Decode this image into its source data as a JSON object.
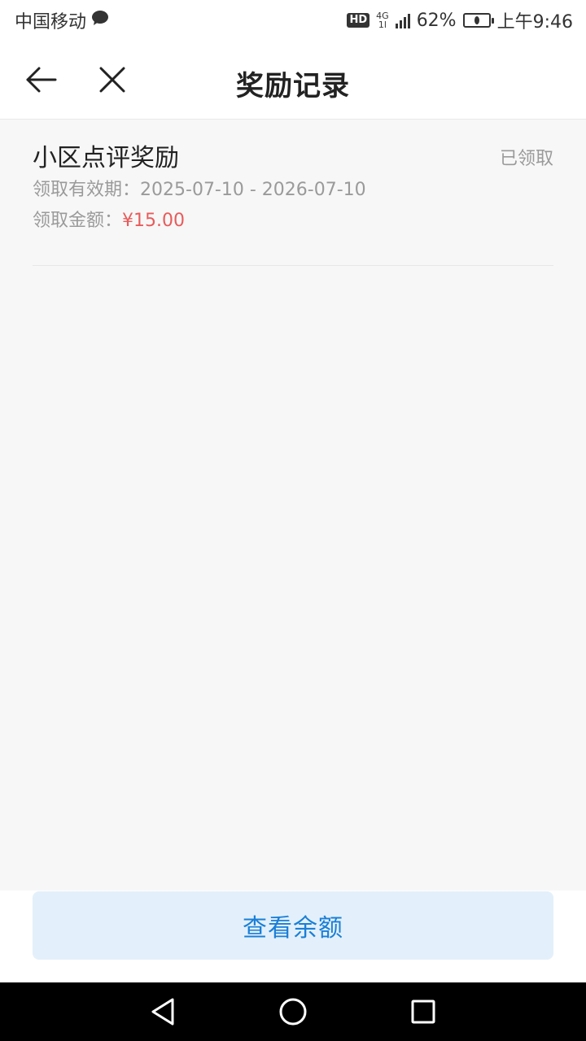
{
  "status_bar": {
    "carrier": "中国移动",
    "hd": "HD",
    "network_top": "4G",
    "network_bottom": "1l",
    "battery": "62%",
    "time": "上午9:46"
  },
  "header": {
    "title": "奖励记录"
  },
  "record": {
    "title": "小区点评奖励",
    "status": "已领取",
    "validity_label": "领取有效期：",
    "validity_value": "2025-07-10 - 2026-07-10",
    "amount_label": "领取金额：",
    "amount_value": "¥15.00"
  },
  "actions": {
    "balance_label": "查看余额"
  },
  "colors": {
    "accent": "#1a7fd6",
    "button_bg": "#e3f0fb",
    "amount_red": "#e85b5b"
  }
}
